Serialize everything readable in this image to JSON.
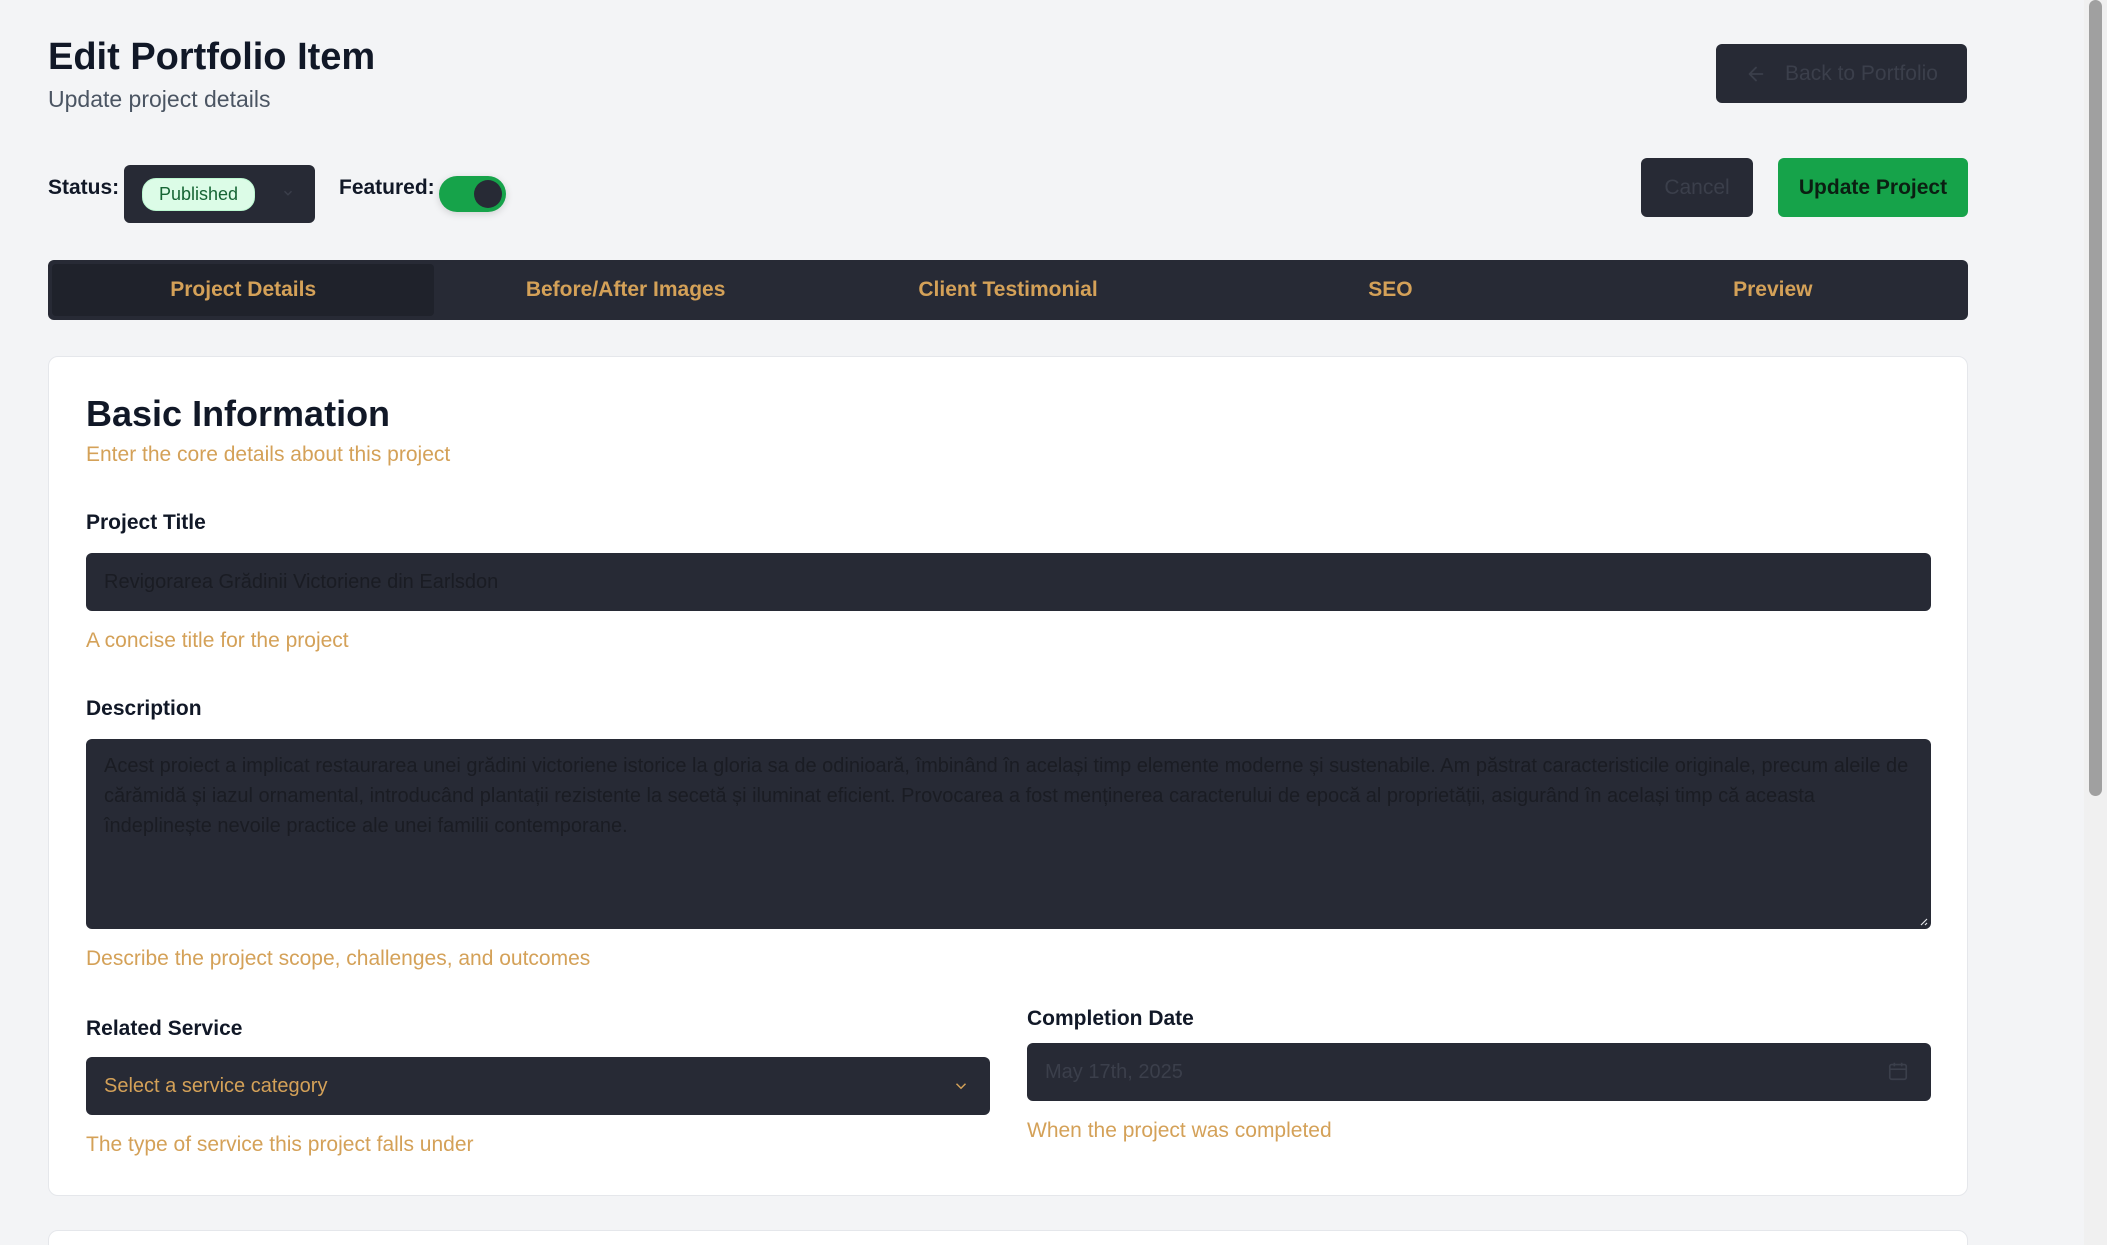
{
  "header": {
    "title": "Edit Portfolio Item",
    "subtitle": "Update project details",
    "back_label": "Back to Portfolio"
  },
  "status": {
    "label": "Status:",
    "value": "Published",
    "featured_label": "Featured:",
    "featured_on": true
  },
  "actions": {
    "cancel_label": "Cancel",
    "update_label": "Update Project"
  },
  "tabs": [
    {
      "label": "Project Details",
      "active": true
    },
    {
      "label": "Before/After Images",
      "active": false
    },
    {
      "label": "Client Testimonial",
      "active": false
    },
    {
      "label": "SEO",
      "active": false
    },
    {
      "label": "Preview",
      "active": false
    }
  ],
  "basic_info": {
    "title": "Basic Information",
    "description": "Enter the core details about this project",
    "project_title": {
      "label": "Project Title",
      "value": "Revigorarea Grădinii Victoriene din Earlsdon",
      "help": "A concise title for the project"
    },
    "description_field": {
      "label": "Description",
      "value": "Acest proiect a implicat restaurarea unei grădini victoriene istorice la gloria sa de odinioară, îmbinând în același timp elemente moderne și sustenabile. Am păstrat caracteristicile originale, precum aleile de cărămidă și iazul ornamental, introducând plantații rezistente la secetă și iluminat eficient. Provocarea a fost menținerea caracterului de epocă al proprietății, asigurând în același timp că aceasta îndeplinește nevoile practice ale unei familii contemporane.",
      "help": "Describe the project scope, challenges, and outcomes"
    },
    "related_service": {
      "label": "Related Service",
      "placeholder": "Select a service category",
      "help": "The type of service this project falls under"
    },
    "completion_date": {
      "label": "Completion Date",
      "value": "May 17th, 2025",
      "help": "When the project was completed"
    }
  },
  "colors": {
    "accent": "#d4a158",
    "primary": "#16a34a",
    "dark_field": "#272a35"
  }
}
